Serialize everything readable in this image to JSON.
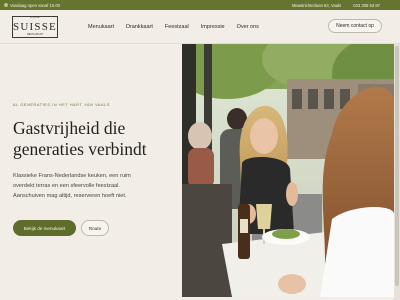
{
  "topbar": {
    "status": "Vandaag open vanaf 10.00",
    "address": "Maastrichterlaan 63, Vaals",
    "phone": "043 308 53 87"
  },
  "logo": {
    "top_text": "CAFE",
    "name": "SUISSE",
    "sub_text": "RESTAURANT"
  },
  "nav": {
    "items": [
      "Menukaart",
      "Drankkaart",
      "Feestzaal",
      "Impressie",
      "Over ons"
    ],
    "contact_label": "Neem contact op"
  },
  "hero": {
    "eyebrow": "Al generaties in het hart van Vaals",
    "headline_line1": "Gastvrijheid die",
    "headline_line2": "generaties verbindt",
    "body_line1": "Klassieke Frans-Nederlandse keuken, een ruim",
    "body_line2": "overdekt terras en een sfeervolle feestzaal.",
    "body_line3": "Aanschuiven mag altijd, reserveren hoeft niet.",
    "primary_button": "Bekijk de menukaart",
    "secondary_button": "Route"
  },
  "colors": {
    "brand_green": "#65752f",
    "background": "#f2eee7"
  }
}
